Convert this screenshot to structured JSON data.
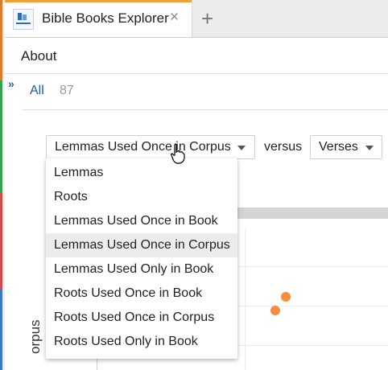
{
  "tab": {
    "title": "Bible Books Explorer",
    "close_glyph": "×",
    "new_tab_glyph": "+"
  },
  "menubar": {
    "about": "About"
  },
  "panel": {
    "toggle_glyph": "»"
  },
  "filter": {
    "all_label": "All",
    "count": "87"
  },
  "controls": {
    "selected_metric": "Lemmas Used Once in Corpus",
    "versus": "versus",
    "compare_metric": "Verses"
  },
  "dropdown_options": [
    "Lemmas",
    "Roots",
    "Lemmas Used Once in Book",
    "Lemmas Used Once in Corpus",
    "Lemmas Used Only in Book",
    "Roots Used Once in Book",
    "Roots Used Once in Corpus",
    "Roots Used Only in Book"
  ],
  "highlighted_option": "Lemmas Used Once in Corpus",
  "chart": {
    "y_label_visible": "orpus"
  },
  "colors": {
    "accent": "#f4a038",
    "link": "#1e5aa8",
    "point": "#f58e3e"
  }
}
